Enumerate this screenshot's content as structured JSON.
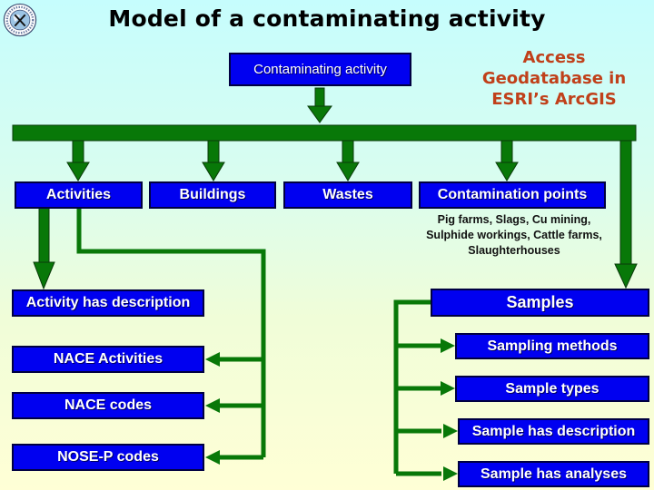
{
  "title": "Model of a contaminating activity",
  "logo_icon": "institution-seal-icon",
  "subtitle_lines": [
    "Access",
    "Geodatabase in",
    "ESRI’s ArcGIS"
  ],
  "colors": {
    "box_fill": "#0000f0",
    "connector_green": "#087808",
    "subtitle_text": "#c0401a"
  },
  "root": {
    "label": "Contaminating activity"
  },
  "level1": [
    {
      "label": "Activities"
    },
    {
      "label": "Buildings"
    },
    {
      "label": "Wastes"
    },
    {
      "label": "Contamination points"
    }
  ],
  "contamination_points_note": "Pig farms, Slags, Cu mining, Sulphide workings, Cattle farms, Slaughterhouses",
  "activity_branch": {
    "label": "Activity has description",
    "children": [
      {
        "label": "NACE Activities"
      },
      {
        "label": "NACE codes"
      },
      {
        "label": "NOSE-P codes"
      }
    ]
  },
  "samples_branch": {
    "label": "Samples",
    "children": [
      {
        "label": "Sampling methods"
      },
      {
        "label": "Sample types"
      },
      {
        "label": "Sample has description"
      },
      {
        "label": "Sample has analyses"
      }
    ]
  }
}
